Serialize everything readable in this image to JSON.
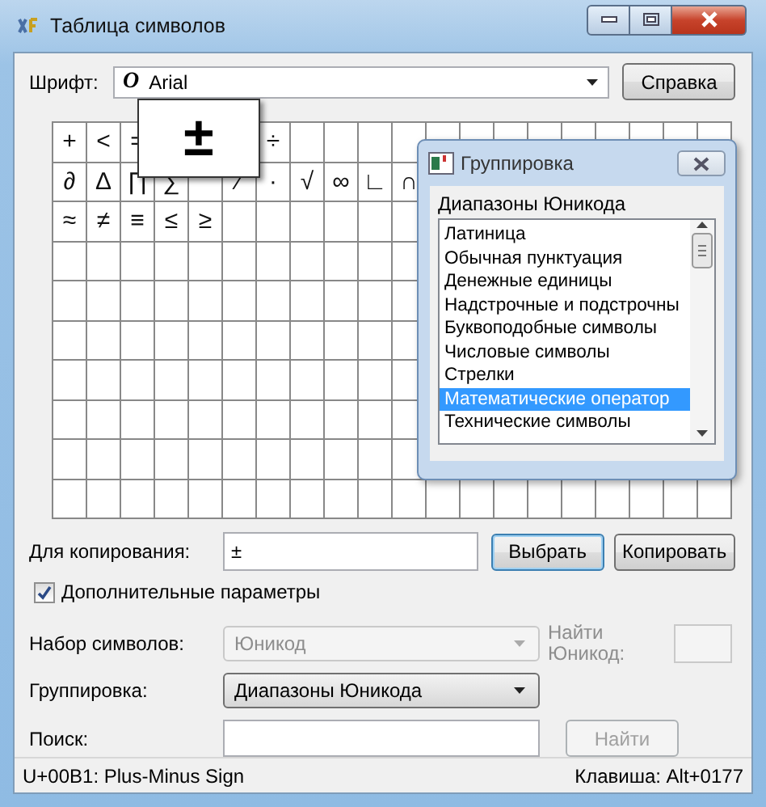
{
  "window": {
    "title": "Таблица символов"
  },
  "font": {
    "label": "Шрифт:",
    "type_glyph": "O",
    "value": "Arial",
    "help_button": "Справка"
  },
  "grid": {
    "rows": [
      [
        "+",
        "<",
        "=",
        null,
        null,
        null,
        "÷"
      ],
      [
        "∂",
        "Δ",
        "∏",
        "∑",
        null,
        "∕",
        "∙",
        "√",
        "∞",
        "∟",
        "∩"
      ],
      [
        "≈",
        "≠",
        "≡",
        "≤",
        "≥"
      ]
    ]
  },
  "magnifier": "±",
  "copy": {
    "label": "Для копирования:",
    "value": "±",
    "select_button": "Выбрать",
    "copy_button": "Копировать"
  },
  "advanced": {
    "label": "Дополнительные параметры",
    "checked": true
  },
  "charset": {
    "label": "Набор символов:",
    "value": "Юникод",
    "disabled": true
  },
  "find_unicode": {
    "label": "Найти Юникод:",
    "disabled": true
  },
  "grouping": {
    "label": "Группировка:",
    "value": "Диапазоны Юникода"
  },
  "search": {
    "label": "Поиск:",
    "button": "Найти",
    "button_disabled": true
  },
  "status_bar": {
    "character": "U+00B1: Plus-Minus Sign",
    "keystroke": "Клавиша: Alt+0177"
  },
  "group_dialog": {
    "title": "Группировка",
    "label": "Диапазоны Юникода",
    "items": [
      {
        "label": "Латиница",
        "selected": false
      },
      {
        "label": "Обычная пунктуация",
        "selected": false
      },
      {
        "label": "Денежные единицы",
        "selected": false
      },
      {
        "label": "Надстрочные и подстрочны",
        "selected": false
      },
      {
        "label": "Буквоподобные символы",
        "selected": false
      },
      {
        "label": "Числовые символы",
        "selected": false
      },
      {
        "label": "Стрелки",
        "selected": false
      },
      {
        "label": "Математические оператор",
        "selected": true
      },
      {
        "label": "Технические символы",
        "selected": false
      }
    ]
  }
}
